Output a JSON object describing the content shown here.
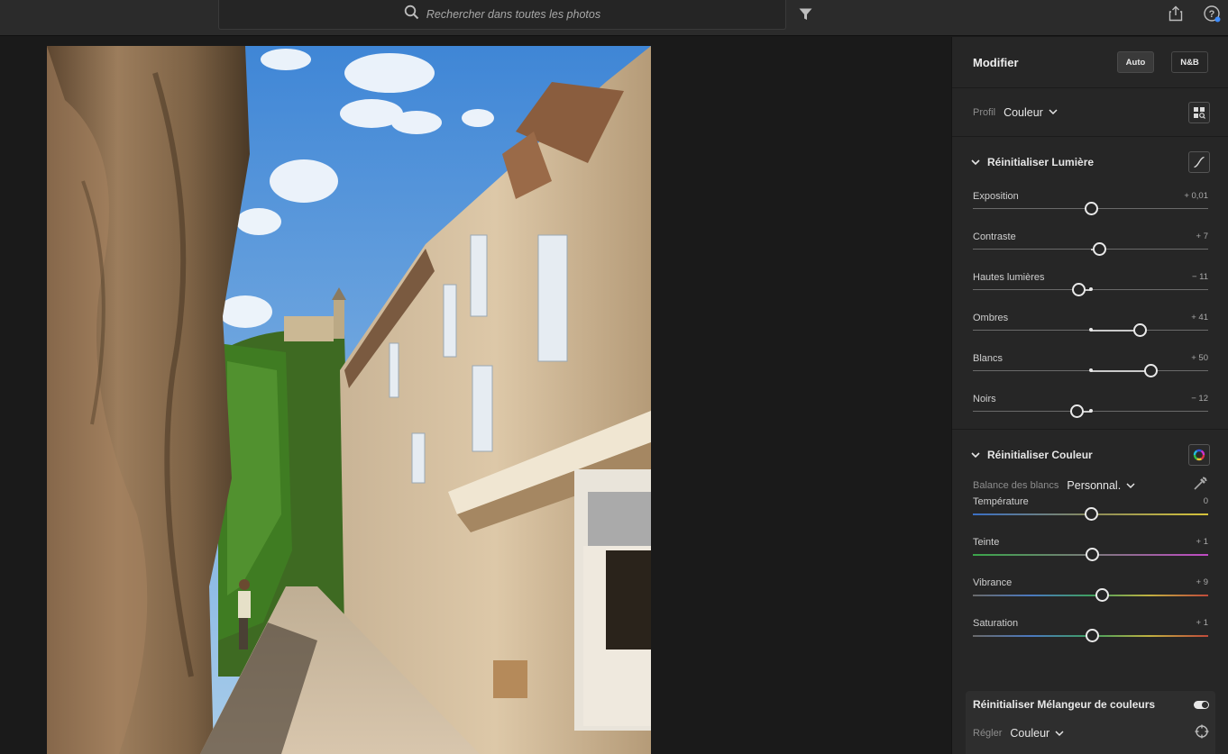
{
  "search": {
    "placeholder": "Rechercher dans toutes les photos",
    "icon": "search-icon"
  },
  "toolbar": {
    "filter_icon": "filter-icon",
    "share_icon": "share-icon",
    "help_icon": "help-icon",
    "notification_color": "#3d8cff"
  },
  "panel": {
    "title": "Modifier",
    "auto_label": "Auto",
    "bw_label": "N&B",
    "profile": {
      "label": "Profil",
      "value": "Couleur"
    }
  },
  "light": {
    "title": "Réinitialiser Lumière",
    "sliders": [
      {
        "label": "Exposition",
        "value": "+ 0,01",
        "level": 0.001
      },
      {
        "label": "Contraste",
        "value": "+ 7",
        "level": 0.07
      },
      {
        "label": "Hautes lumières",
        "value": "− 11",
        "level": -0.11
      },
      {
        "label": "Ombres",
        "value": "+ 41",
        "level": 0.41
      },
      {
        "label": "Blancs",
        "value": "+ 50",
        "level": 0.5
      },
      {
        "label": "Noirs",
        "value": "− 12",
        "level": -0.12
      }
    ]
  },
  "color": {
    "title": "Réinitialiser Couleur",
    "wb_label": "Balance des blancs",
    "wb_value": "Personnal.",
    "sliders": [
      {
        "label": "Température",
        "value": "0",
        "level": 0,
        "gradient": "linear-gradient(90deg,#3a6fc4,#8a8a5a,#d6c33a)"
      },
      {
        "label": "Teinte",
        "value": "+ 1",
        "level": 0.01,
        "gradient": "linear-gradient(90deg,#3aa54a,#7a7a7a,#c04ac4)"
      },
      {
        "label": "Vibrance",
        "value": "+ 9",
        "level": 0.09,
        "gradient": "linear-gradient(90deg,#6a6a6a,#4a78c0,#3fa060,#c0b040,#c04a3a)"
      },
      {
        "label": "Saturation",
        "value": "+ 1",
        "level": 0.01,
        "gradient": "linear-gradient(90deg,#6a6a6a,#4a78c0,#3fa060,#c0b040,#c04a3a)"
      }
    ]
  },
  "mixer": {
    "title": "Réinitialiser Mélangeur de couleurs",
    "adjust_label": "Régler",
    "adjust_value": "Couleur"
  }
}
